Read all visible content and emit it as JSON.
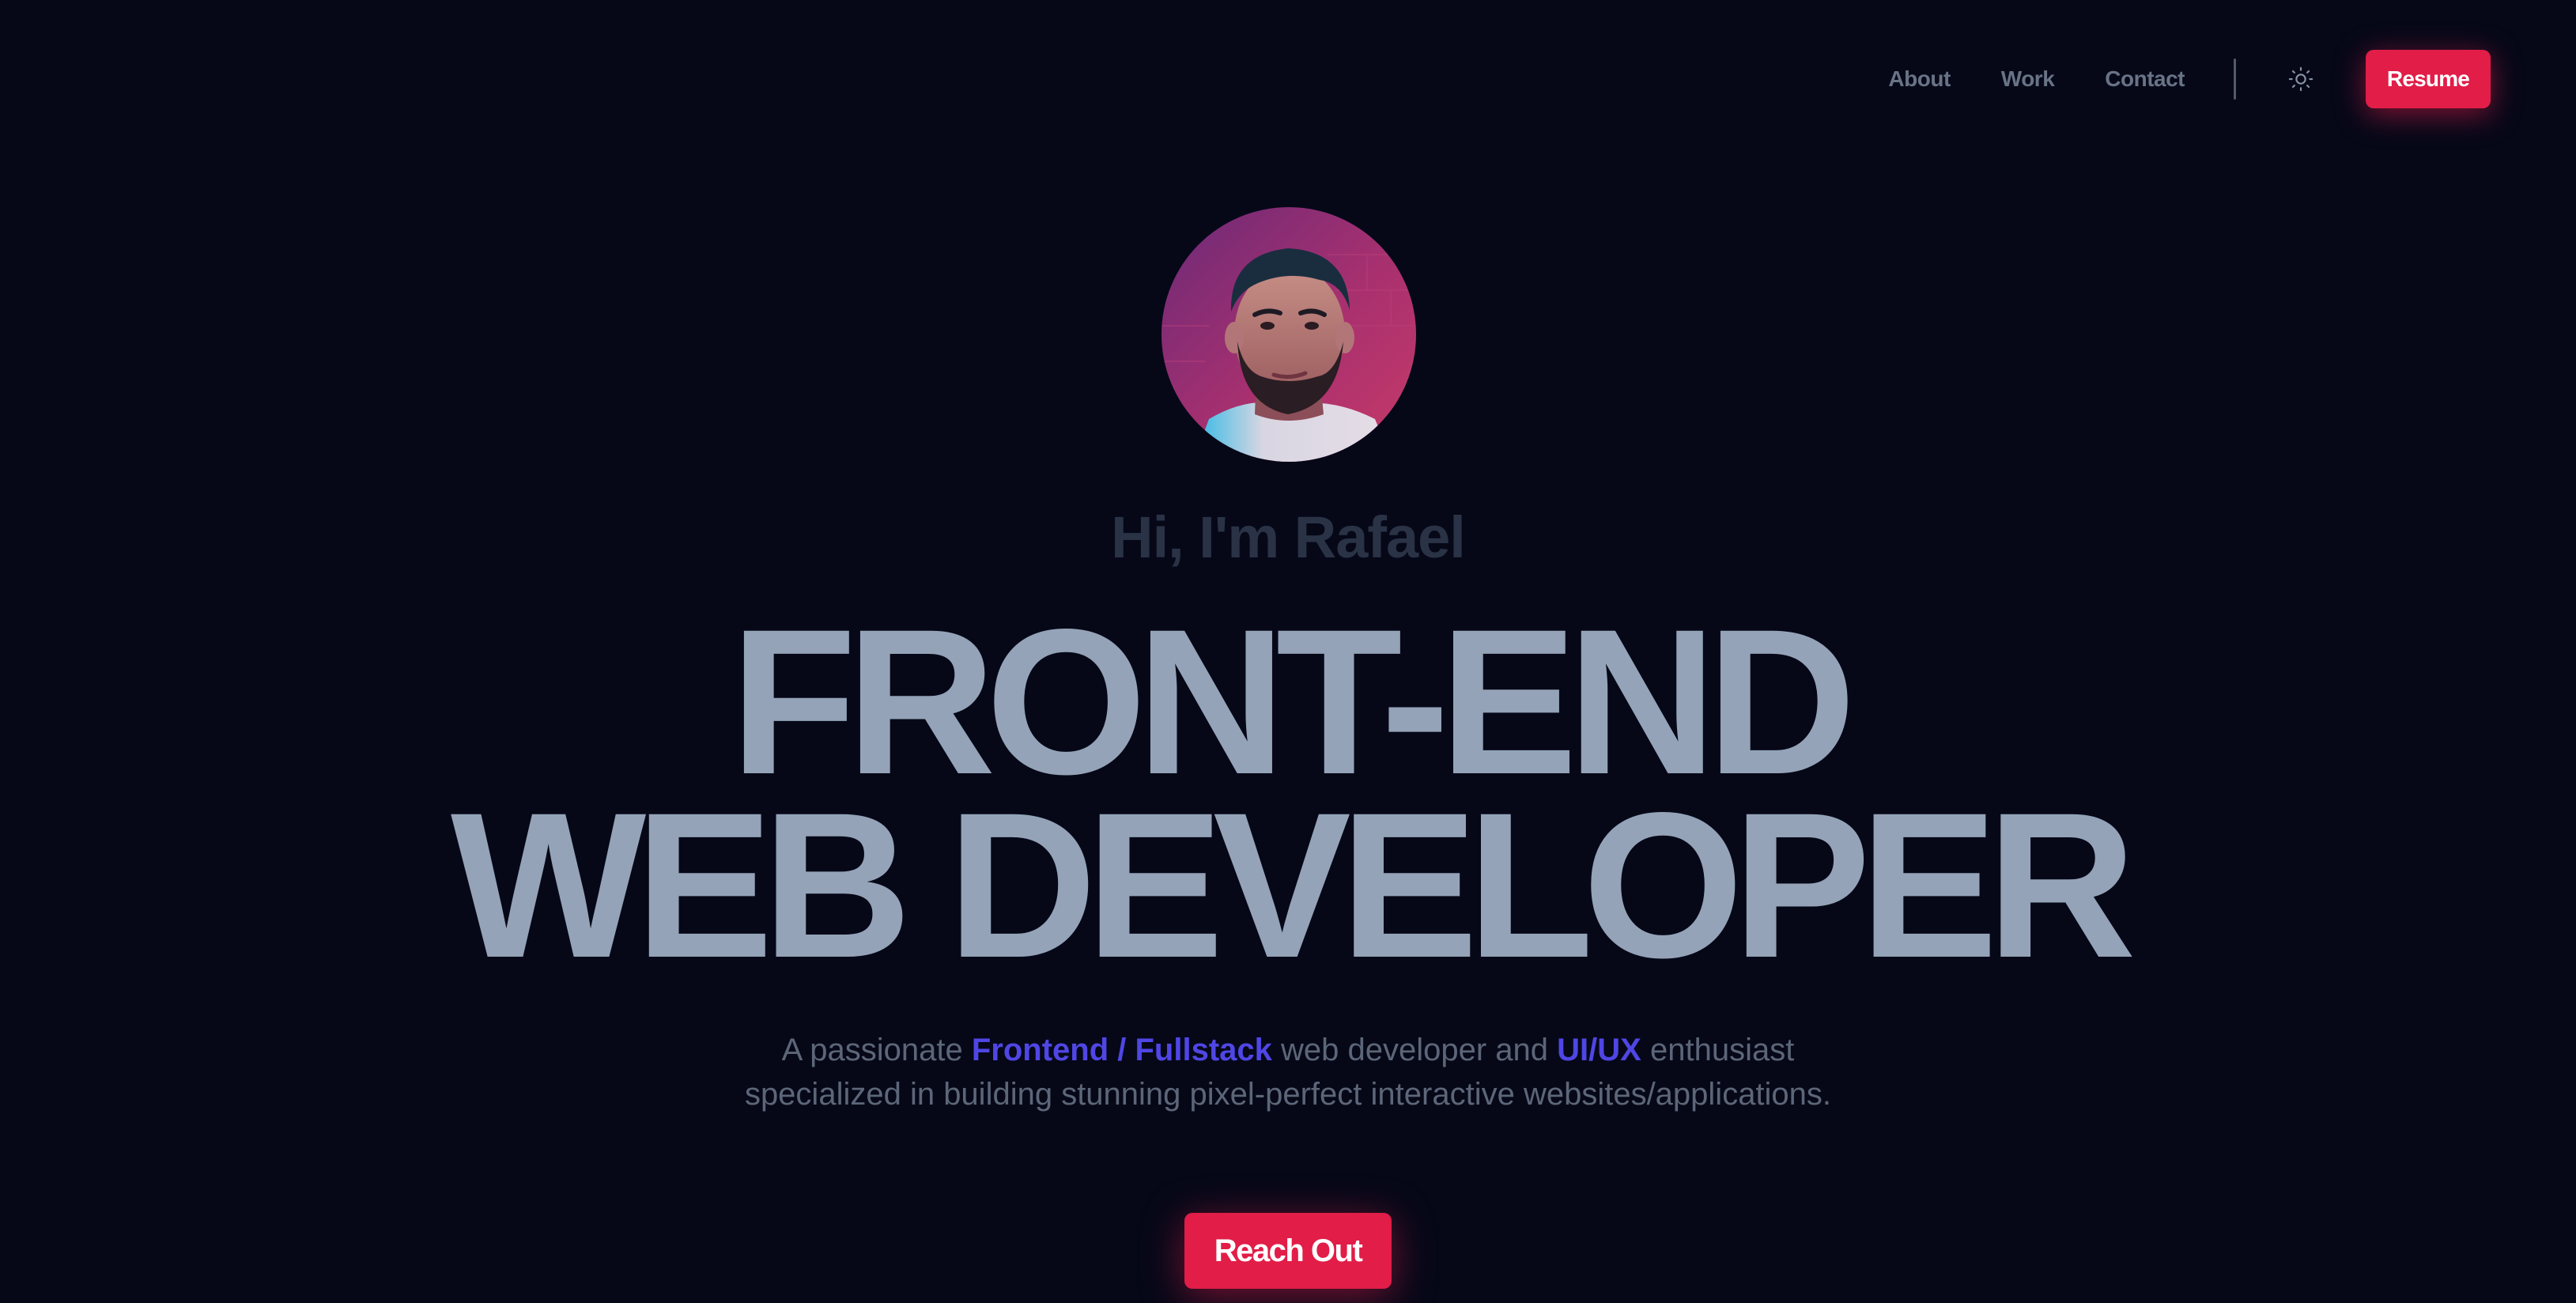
{
  "nav": {
    "links": [
      {
        "label": "About"
      },
      {
        "label": "Work"
      },
      {
        "label": "Contact"
      }
    ],
    "theme_toggle_icon": "sun-icon",
    "resume_label": "Resume"
  },
  "hero": {
    "avatar_alt": "profile-photo",
    "greeting": "Hi, I'm Rafael",
    "headline_line1": "FRONT-END",
    "headline_line2": "WEB DEVELOPER",
    "tagline": {
      "part1": "A passionate ",
      "highlight1": "Frontend / Fullstack",
      "part2": " web developer and ",
      "highlight2": "UI/UX",
      "part3": " enthusiast specialized in building stunning pixel-perfect interactive websites/applications."
    },
    "cta_label": "Reach Out"
  },
  "colors": {
    "background": "#060818",
    "accent": "#e11d48",
    "highlight": "#4f46e5",
    "headline": "#94a3b8",
    "muted": "#5c6678"
  }
}
